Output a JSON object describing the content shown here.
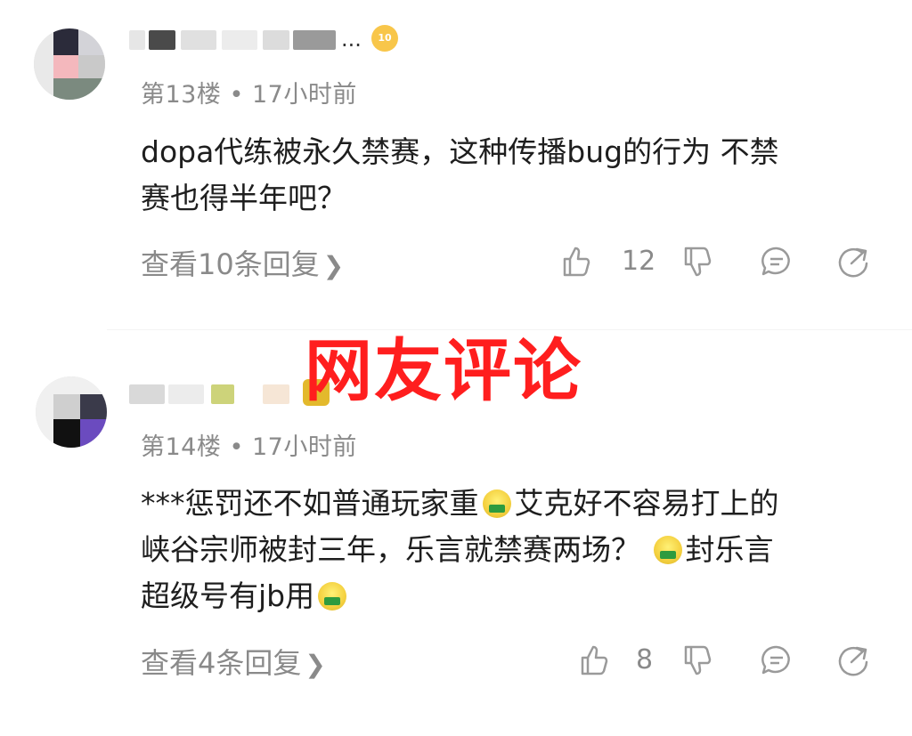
{
  "comments": [
    {
      "floor_label": "第13楼",
      "separator": "•",
      "time": "17小时前",
      "text": "dopa代练被永久禁赛，这种传播bug的行为 不禁\n赛也得半年吧？",
      "replies_label": "查看10条回复",
      "like_count": "12",
      "badge": "10",
      "name_suffix": "..."
    },
    {
      "floor_label": "第14楼",
      "separator": "•",
      "time": "17小时前",
      "text_part1": "***惩罚还不如普通玩家重",
      "text_part2": "艾克好不容易打上的\n峡谷宗师被封三年，乐言就禁赛两场？",
      "text_part3": "封乐言\n超级号有jb用",
      "replies_label": "查看4条回复",
      "like_count": "8"
    }
  ],
  "overlay_title": "网友评论",
  "icons": {
    "like": "thumb-up-icon",
    "dislike": "thumb-down-icon",
    "reply": "comment-bubble-icon",
    "share": "share-icon",
    "emoji": "vomit-emoji-icon"
  },
  "colors": {
    "overlay": "#ff1e1e",
    "meta": "#8a8a8a",
    "text": "#1e1e1e"
  }
}
